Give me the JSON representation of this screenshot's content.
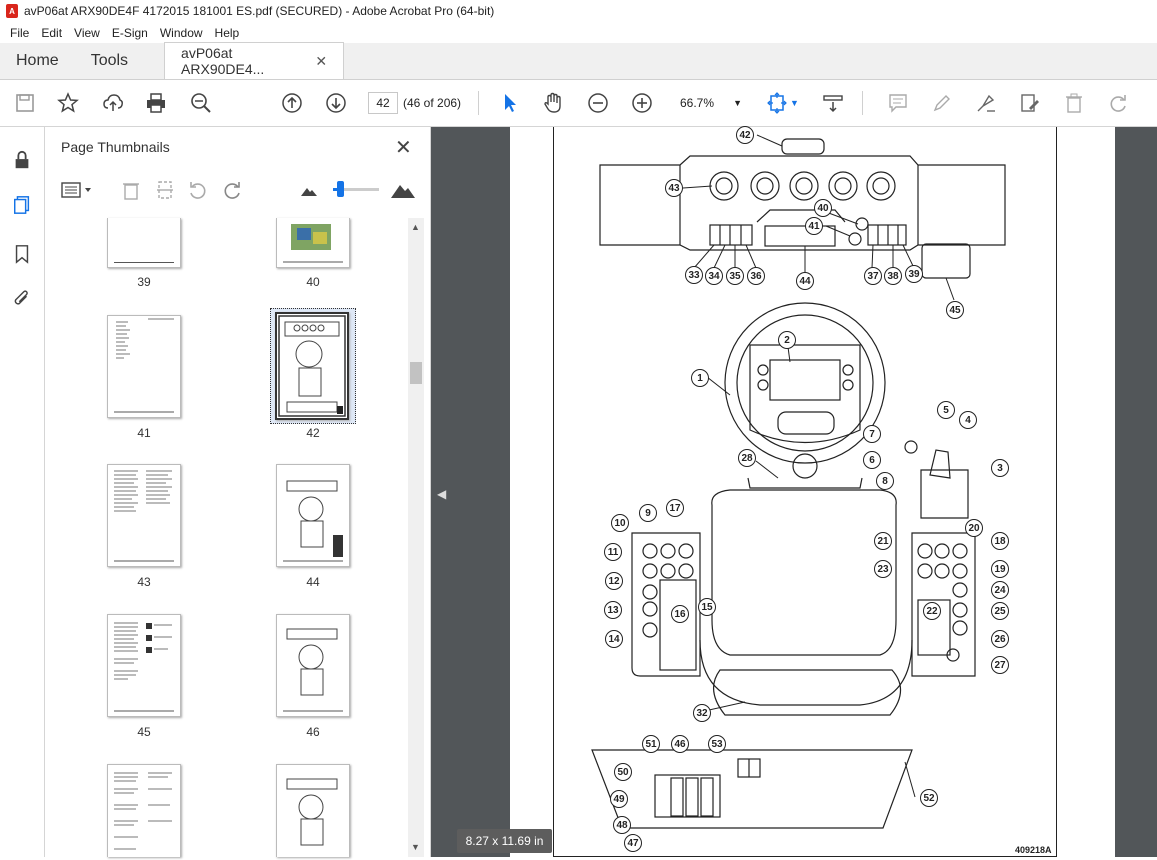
{
  "window": {
    "title": "avP06at ARX90DE4F 4172015 181001 ES.pdf (SECURED) - Adobe Acrobat Pro (64-bit)"
  },
  "menu": [
    "File",
    "Edit",
    "View",
    "E-Sign",
    "Window",
    "Help"
  ],
  "tabs": {
    "home": "Home",
    "tools": "Tools",
    "doc": "avP06at ARX90DE4..."
  },
  "toolbar": {
    "page_number": "42",
    "page_count": "(46 of 206)",
    "zoom": "66.7%"
  },
  "panel": {
    "title": "Page Thumbnails",
    "thumbnails": [
      "39",
      "40",
      "41",
      "42",
      "43",
      "44",
      "45",
      "46"
    ]
  },
  "viewer": {
    "page_size": "8.27 x 11.69 in",
    "figure_code": "409218A"
  },
  "callouts": [
    "1",
    "2",
    "3",
    "4",
    "5",
    "6",
    "7",
    "8",
    "9",
    "10",
    "11",
    "12",
    "13",
    "14",
    "15",
    "16",
    "17",
    "18",
    "19",
    "20",
    "21",
    "22",
    "23",
    "24",
    "25",
    "26",
    "27",
    "28",
    "32",
    "33",
    "34",
    "35",
    "36",
    "37",
    "38",
    "39",
    "40",
    "41",
    "42",
    "43",
    "44",
    "45",
    "46",
    "47",
    "48",
    "49",
    "50",
    "51",
    "52",
    "53"
  ]
}
